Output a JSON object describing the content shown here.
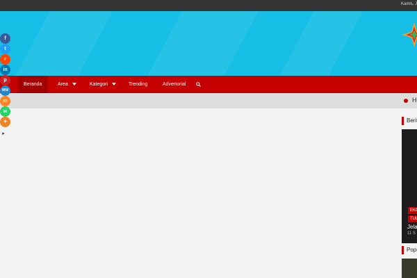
{
  "topbar": {
    "date": "Kamis, J"
  },
  "nav": {
    "items": [
      {
        "label": "Beranda"
      },
      {
        "label": "Area"
      },
      {
        "label": "Kategori"
      },
      {
        "label": "Trending"
      },
      {
        "label": "Advertorial"
      }
    ]
  },
  "ticker": {
    "label": "H"
  },
  "share": {
    "buttons": [
      {
        "icon": "facebook-icon",
        "glyph": "f",
        "color": "#3b5998"
      },
      {
        "icon": "twitter-icon",
        "glyph": "t",
        "color": "#1da1f2"
      },
      {
        "icon": "reddit-icon",
        "glyph": "r",
        "color": "#ff4500"
      },
      {
        "icon": "linkedin-icon",
        "glyph": "in",
        "color": "#0077b5"
      },
      {
        "icon": "pinterest-icon",
        "glyph": "p",
        "color": "#cb2027"
      },
      {
        "icon": "mewe-icon",
        "glyph": "MW",
        "color": "#1e8bd0"
      },
      {
        "icon": "mix-icon",
        "glyph": "m",
        "color": "#ff8226"
      },
      {
        "icon": "whatsapp-icon",
        "glyph": "w",
        "color": "#25d366"
      },
      {
        "icon": "more-icon",
        "glyph": "+",
        "color": "#f58220"
      }
    ]
  },
  "sidebar": {
    "berita_title": "Berit",
    "tags": [
      "EKO",
      "TUL"
    ],
    "headline": "Jela",
    "meta": "11 S",
    "popular_title": "Popu"
  },
  "colors": {
    "brand_red": "#c40000",
    "header_blue": "#17bfe6",
    "topbar": "#333333"
  }
}
